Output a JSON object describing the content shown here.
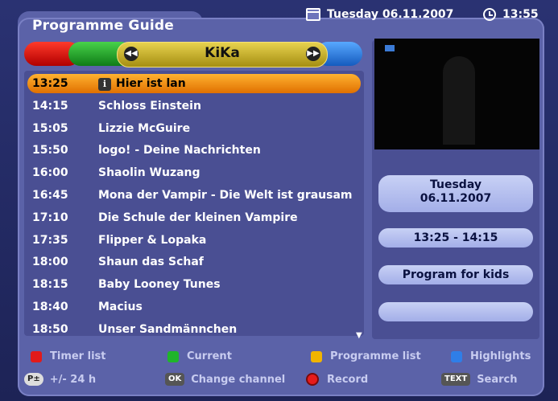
{
  "header": {
    "title": "Programme Guide",
    "date": "Tuesday 06.11.2007",
    "time": "13:55"
  },
  "channel": {
    "name": "KiKa",
    "prev_icon": "rewind-icon",
    "next_icon": "forward-icon"
  },
  "programmes": [
    {
      "time": "13:25",
      "title": "Hier ist lan",
      "selected": true
    },
    {
      "time": "14:15",
      "title": "Schloss Einstein"
    },
    {
      "time": "15:05",
      "title": "Lizzie McGuire"
    },
    {
      "time": "15:50",
      "title": "logo! - Deine Nachrichten"
    },
    {
      "time": "16:00",
      "title": "Shaolin Wuzang"
    },
    {
      "time": "16:45",
      "title": "Mona der Vampir - Die Welt ist grausam"
    },
    {
      "time": "17:10",
      "title": "Die Schule der kleinen Vampire"
    },
    {
      "time": "17:35",
      "title": "Flipper & Lopaka"
    },
    {
      "time": "18:00",
      "title": "Shaun das Schaf"
    },
    {
      "time": "18:15",
      "title": "Baby Looney Tunes"
    },
    {
      "time": "18:40",
      "title": "Macius"
    },
    {
      "time": "18:50",
      "title": "Unser Sandmännchen"
    }
  ],
  "details": {
    "day": "Tuesday",
    "date": "06.11.2007",
    "timespan": "13:25 - 14:15",
    "genre": "Program for kids",
    "extra": ""
  },
  "footer": {
    "timer_list": "Timer list",
    "current": "Current",
    "programme_list": "Programme list",
    "highlights": "Highlights",
    "plusminus_badge": "P±",
    "plusminus_label": "+/- 24 h",
    "ok_badge": "OK",
    "ok_label": "Change channel",
    "record_label": "Record",
    "text_badge": "TEXT",
    "search_label": "Search"
  },
  "colors": {
    "red": "#e21a1a",
    "green": "#1fb52a",
    "yellow": "#f1b400",
    "blue": "#2f7ee8",
    "selected": "#ff9a1a"
  }
}
